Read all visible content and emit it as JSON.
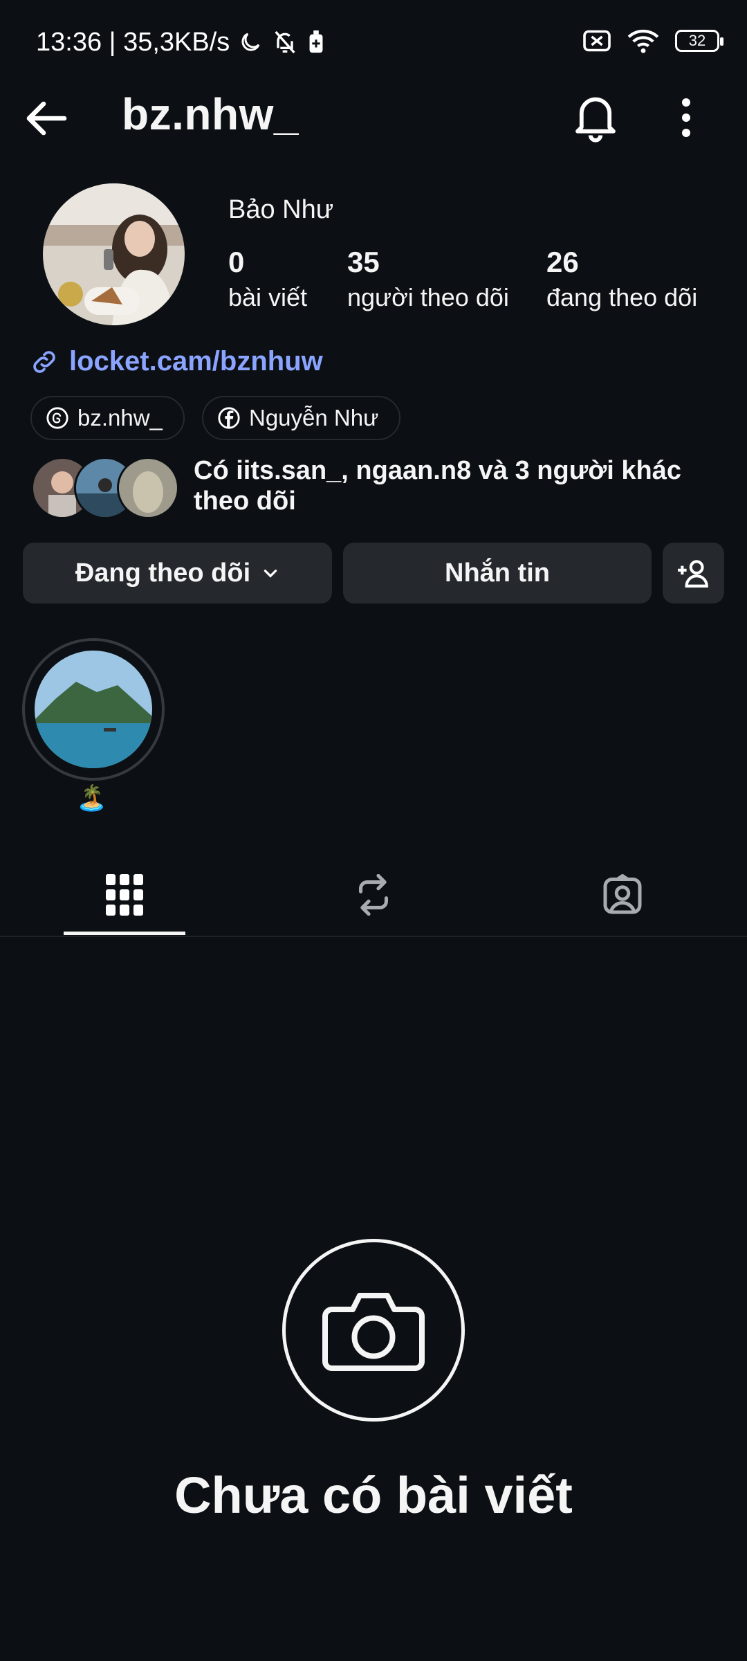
{
  "status_bar": {
    "time_speed": "13:36 | 35,3KB/s",
    "battery": "32"
  },
  "header": {
    "username": "bz.nhw_"
  },
  "profile": {
    "display_name": "Bảo Như",
    "stats": [
      {
        "value": "0",
        "label": "bài viết"
      },
      {
        "value": "35",
        "label": "người theo dõi"
      },
      {
        "value": "26",
        "label": "đang theo dõi"
      }
    ],
    "link": "locket.cam/bznhuw",
    "threads_handle": "bz.nhw_",
    "facebook_name": "Nguyễn Như",
    "mutual_followers": "Có iits.san_, ngaan.n8 và 3 người khác theo dõi"
  },
  "actions": {
    "following_label": "Đang theo dõi",
    "message_label": "Nhắn tin"
  },
  "highlights": [
    {
      "label": "🏝️"
    }
  ],
  "tabs": [
    "grid-icon",
    "reposts-icon",
    "tagged-icon"
  ],
  "empty_state": {
    "title": "Chưa có bài viết"
  },
  "colors": {
    "background": "#0c1014",
    "link": "#8aa4ff",
    "button": "#25292e"
  }
}
